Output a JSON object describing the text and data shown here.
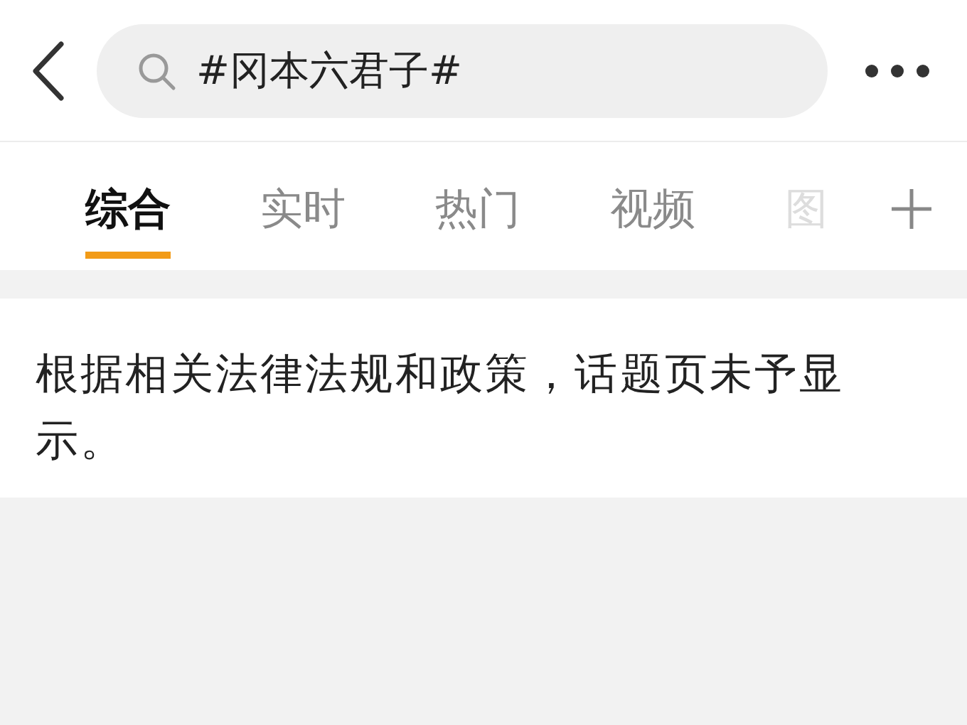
{
  "search": {
    "value": "#冈本六君子#"
  },
  "tabs": [
    {
      "label": "综合",
      "selected": true
    },
    {
      "label": "实时",
      "selected": false
    },
    {
      "label": "热门",
      "selected": false
    },
    {
      "label": "视频",
      "selected": false
    },
    {
      "label": "图",
      "selected": false
    }
  ],
  "notice": "根据相关法律法规和政策，话题页未予显示。"
}
